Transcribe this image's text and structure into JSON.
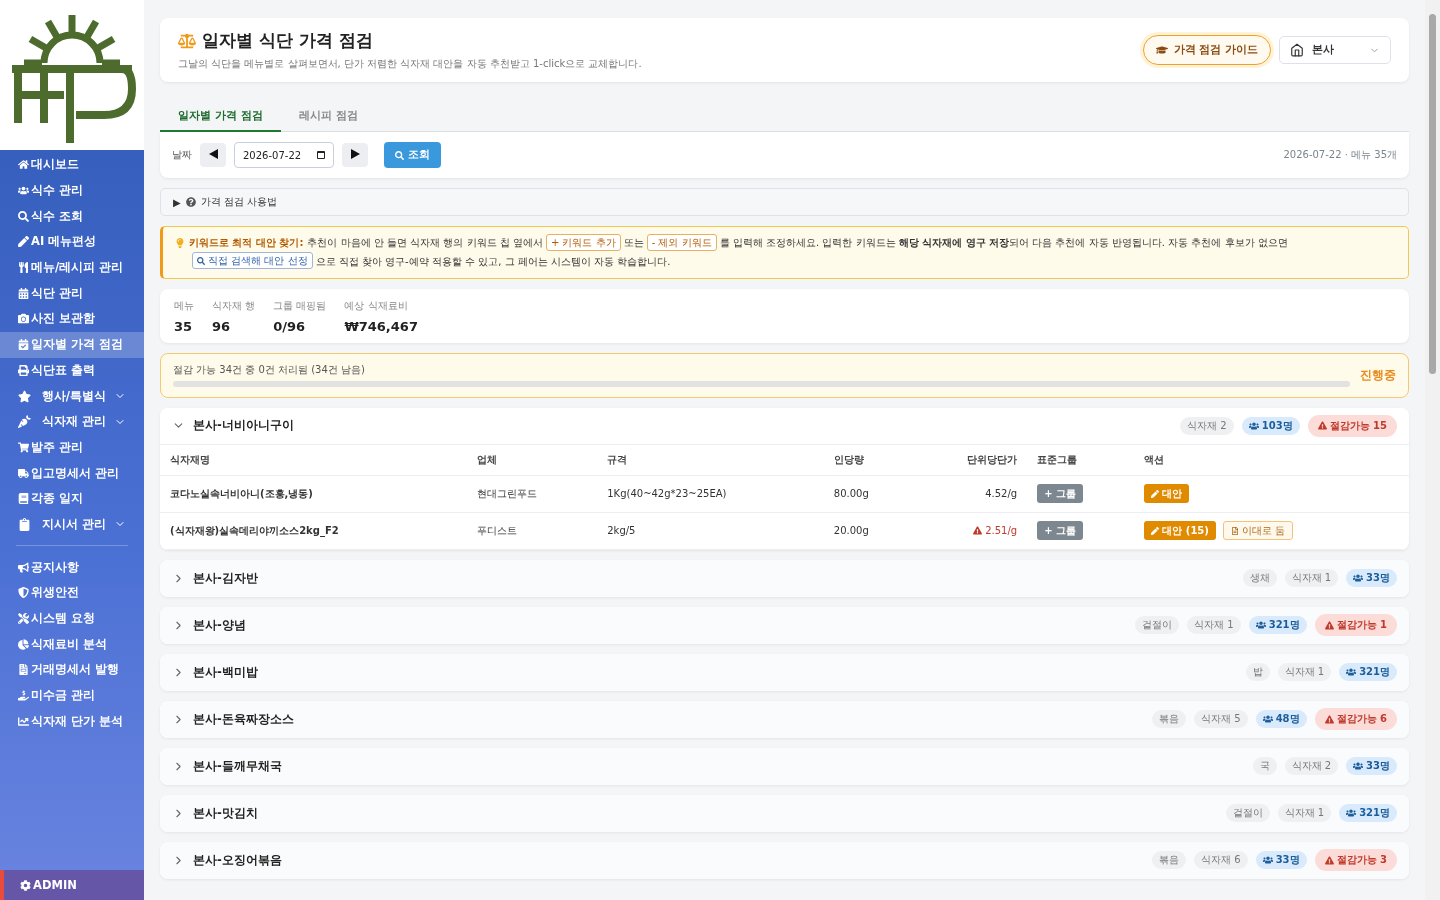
{
  "sidebar": {
    "items": [
      {
        "label": "대시보드",
        "kind": "link",
        "selected": false
      },
      {
        "label": "식수 관리",
        "kind": "link",
        "selected": false
      },
      {
        "label": "식수 조회",
        "kind": "link",
        "selected": false
      },
      {
        "label": "AI 메뉴편성",
        "kind": "link",
        "selected": false
      },
      {
        "label": "메뉴/레시피 관리",
        "kind": "link",
        "selected": false
      },
      {
        "label": "식단 관리",
        "kind": "link",
        "selected": false
      },
      {
        "label": "사진 보관함",
        "kind": "link",
        "selected": false
      },
      {
        "label": "일자별 가격 점검",
        "kind": "link",
        "selected": true
      },
      {
        "label": "식단표 출력",
        "kind": "link",
        "selected": false
      },
      {
        "label": "행사/특별식",
        "kind": "group",
        "selected": false,
        "expanded": false
      },
      {
        "label": "식자재 관리",
        "kind": "group",
        "selected": false,
        "expanded": false
      },
      {
        "label": "발주 관리",
        "kind": "link",
        "selected": false
      },
      {
        "label": "입고명세서 관리",
        "kind": "link",
        "selected": false
      },
      {
        "label": "각종 일지",
        "kind": "link",
        "selected": false
      },
      {
        "label": "지시서 관리",
        "kind": "group",
        "selected": false,
        "expanded": false
      },
      {
        "kind": "divider"
      },
      {
        "label": "공지사항",
        "kind": "link",
        "selected": false
      },
      {
        "label": "위생안전",
        "kind": "link",
        "selected": false
      },
      {
        "label": "시스템 요청",
        "kind": "link",
        "selected": false
      },
      {
        "label": "식재료비 분석",
        "kind": "link",
        "selected": false
      },
      {
        "label": "거래명세서 발행",
        "kind": "link",
        "selected": false
      },
      {
        "label": "미수금 관리",
        "kind": "link",
        "selected": false
      },
      {
        "label": "식자재 단가 분석",
        "kind": "link",
        "selected": false
      }
    ],
    "admin": "ADMIN"
  },
  "header": {
    "title": "일자별 식단 가격 점검",
    "subtitle": "그날의 식단을 메뉴별로 살펴보면서, 단가 저렴한 식자재 대안을 자동 추천받고 1-click으로 교체합니다.",
    "guide_button": "가격 점검 가이드",
    "site_select": "본사"
  },
  "tabs": [
    {
      "label": "일자별 가격 점검",
      "selected": true
    },
    {
      "label": "레시피 점검",
      "selected": false
    }
  ],
  "date_bar": {
    "label": "날짜",
    "date": "2026-07-22",
    "search_button": "조회",
    "summary": "2026-07-22 · 메뉴 35개"
  },
  "guide_toggle": {
    "arrow": "▶",
    "label": "가격 점검 사용법",
    "expanded": false
  },
  "tip": {
    "title": "키워드로 최적 대안 찾기:",
    "parts": [
      {
        "kind": "text",
        "text": "추천이 마음에 안 들면 식자재 행의 키워드 칩 옆에서"
      },
      {
        "kind": "chip",
        "text": "+ 키워드 추가"
      },
      {
        "kind": "text",
        "text": "또는"
      },
      {
        "kind": "chip",
        "text": "- 제외 키워드"
      },
      {
        "kind": "text",
        "text": "를 입력해 조정하세요. 입력한 키워드는 **해당 식자재에 영구 저장**되어 다음 추천에 자동 반영됩니다. 자동 추천에 후보가 없으면"
      },
      {
        "kind": "search_chip",
        "text": "직접 검색해 대안 선정"
      },
      {
        "kind": "text",
        "text": "으로 직접 찾아 영구-예약 적용할 수 있고, 그 페어는 시스템이 자동 학습합니다."
      }
    ]
  },
  "stats": [
    {
      "label": "메뉴",
      "value": "35"
    },
    {
      "label": "식자재 행",
      "value": "96"
    },
    {
      "label": "그룹 매핑됨",
      "value": "0/96"
    },
    {
      "label": "예상 식재료비",
      "value": "₩746,467"
    }
  ],
  "progress": {
    "text": "절감 가능 34건 중 0건 처리됨 (34건 남음)",
    "level": 0,
    "status": "진행중"
  },
  "menus": [
    {
      "title": "본사-너비아니구이",
      "expanded": true,
      "chips": [
        {
          "kind": "count",
          "text": "식자재 2"
        },
        {
          "kind": "people",
          "text": "103명"
        },
        {
          "kind": "saving",
          "text": "절감가능 15"
        }
      ],
      "table": {
        "columns": [
          "식자재명",
          "업체",
          "규격",
          "인당량",
          "단위당단가",
          "표준그룹",
          "액션"
        ],
        "rows": [
          {
            "name": "코다노실속너비아니(조흥,냉동)",
            "vendor": "현대그린푸드",
            "spec": "1Kg(40~42g*23~25EA)",
            "portion": "80.00g",
            "unit_price": "4.52/g",
            "warning": false,
            "group_button": "+ 그룹",
            "alt_button": "대안",
            "keep_button": null
          },
          {
            "name": "(식자재왕)실속데리야끼소스2kg_F2",
            "vendor": "푸디스트",
            "spec": "2kg/5",
            "portion": "20.00g",
            "unit_price": "2.51/g",
            "warning": true,
            "group_button": "+ 그룹",
            "alt_button": "대안 (15)",
            "keep_button": "이대로 둠"
          }
        ]
      }
    },
    {
      "title": "본사-김자반",
      "expanded": false,
      "chips": [
        {
          "kind": "tag",
          "text": "생채"
        },
        {
          "kind": "count",
          "text": "식자재 1"
        },
        {
          "kind": "people",
          "text": "33명"
        }
      ]
    },
    {
      "title": "본사-양념",
      "expanded": false,
      "chips": [
        {
          "kind": "tag",
          "text": "겉절이"
        },
        {
          "kind": "count",
          "text": "식자재 1"
        },
        {
          "kind": "people",
          "text": "321명"
        },
        {
          "kind": "saving",
          "text": "절감가능 1"
        }
      ]
    },
    {
      "title": "본사-백미밥",
      "expanded": false,
      "chips": [
        {
          "kind": "tag",
          "text": "밥"
        },
        {
          "kind": "count",
          "text": "식자재 1"
        },
        {
          "kind": "people",
          "text": "321명"
        }
      ]
    },
    {
      "title": "본사-돈육짜장소스",
      "expanded": false,
      "chips": [
        {
          "kind": "tag",
          "text": "볶음"
        },
        {
          "kind": "count",
          "text": "식자재 5"
        },
        {
          "kind": "people",
          "text": "48명"
        },
        {
          "kind": "saving",
          "text": "절감가능 6"
        }
      ]
    },
    {
      "title": "본사-들깨무채국",
      "expanded": false,
      "chips": [
        {
          "kind": "tag",
          "text": "국"
        },
        {
          "kind": "count",
          "text": "식자재 2"
        },
        {
          "kind": "people",
          "text": "33명"
        }
      ]
    },
    {
      "title": "본사-맛김치",
      "expanded": false,
      "chips": [
        {
          "kind": "tag",
          "text": "겉절이"
        },
        {
          "kind": "count",
          "text": "식자재 1"
        },
        {
          "kind": "people",
          "text": "321명"
        }
      ]
    },
    {
      "title": "본사-오징어볶음",
      "expanded": false,
      "chips": [
        {
          "kind": "tag",
          "text": "볶음"
        },
        {
          "kind": "count",
          "text": "식자재 6"
        },
        {
          "kind": "people",
          "text": "33명"
        },
        {
          "kind": "saving",
          "text": "절감가능 3"
        }
      ]
    }
  ]
}
